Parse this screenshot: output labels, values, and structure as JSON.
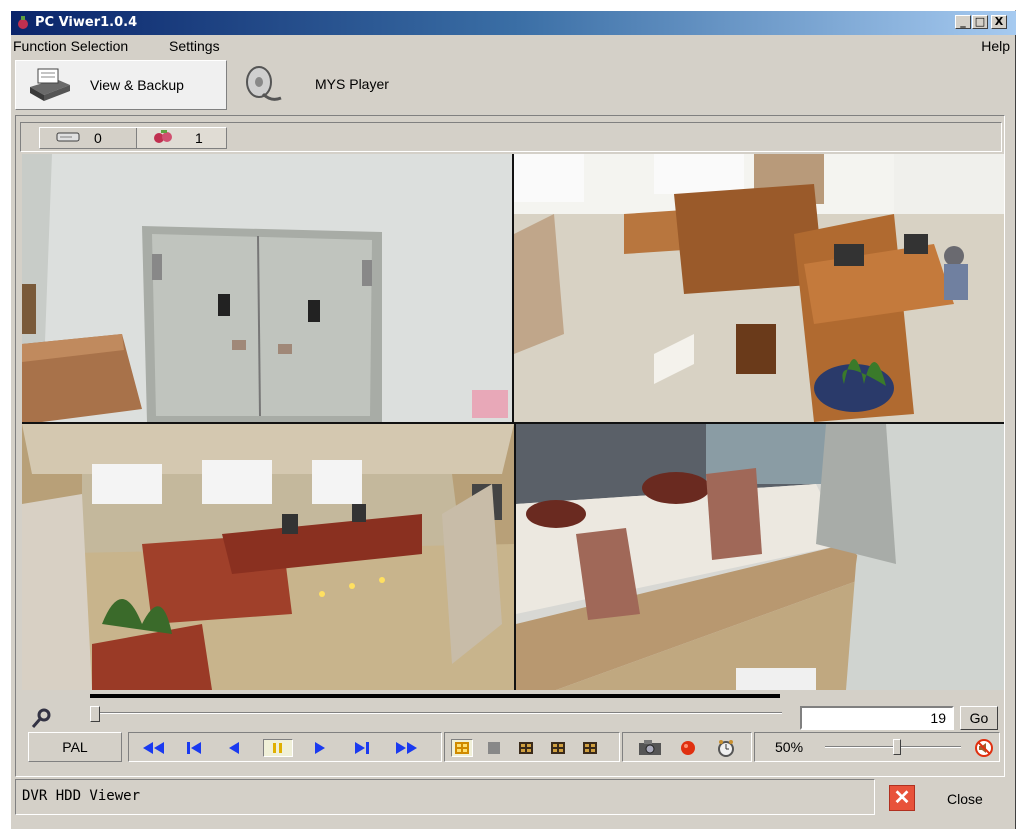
{
  "window": {
    "title": "PC Viwer1.0.4",
    "controls": {
      "minimize": "_",
      "maximize": "□",
      "close": "X"
    }
  },
  "menu": {
    "items": [
      "Function Selection",
      "Settings"
    ],
    "help": "Help"
  },
  "modes": [
    {
      "label": "View & Backup",
      "icon": "dvr-printer-icon",
      "selected": true
    },
    {
      "label": "MYS Player",
      "icon": "film-reel-icon",
      "selected": false
    }
  ],
  "channels": [
    {
      "icon": "hdd-icon",
      "count": "0"
    },
    {
      "icon": "camera-group-icon",
      "count": "1"
    }
  ],
  "cameras": [
    {
      "scene": "door"
    },
    {
      "scene": "office-desks"
    },
    {
      "scene": "office-wide"
    },
    {
      "scene": "counter"
    }
  ],
  "playback": {
    "frame": "19",
    "go_label": "Go",
    "format": "PAL",
    "position": 0.0,
    "buttons": [
      "fast-rewind-icon",
      "skip-start-icon",
      "step-back-icon",
      "pause-icon",
      "play-icon",
      "skip-end-icon",
      "fast-forward-icon"
    ]
  },
  "layouts": [
    "quad-layout-icon",
    "single-layout-icon",
    "grid-layout-icon",
    "grid-layout-icon",
    "grid-layout-icon"
  ],
  "media": [
    "snapshot-icon",
    "record-icon",
    "clock-icon"
  ],
  "volume": {
    "label": "50%",
    "level": 0.5
  },
  "status": {
    "text": "DVR HDD Viewer"
  },
  "close": {
    "label": "Close"
  },
  "colors": {
    "titlebar": "#0a246a",
    "face": "#d4d0c8",
    "accent": "#0000ff"
  }
}
